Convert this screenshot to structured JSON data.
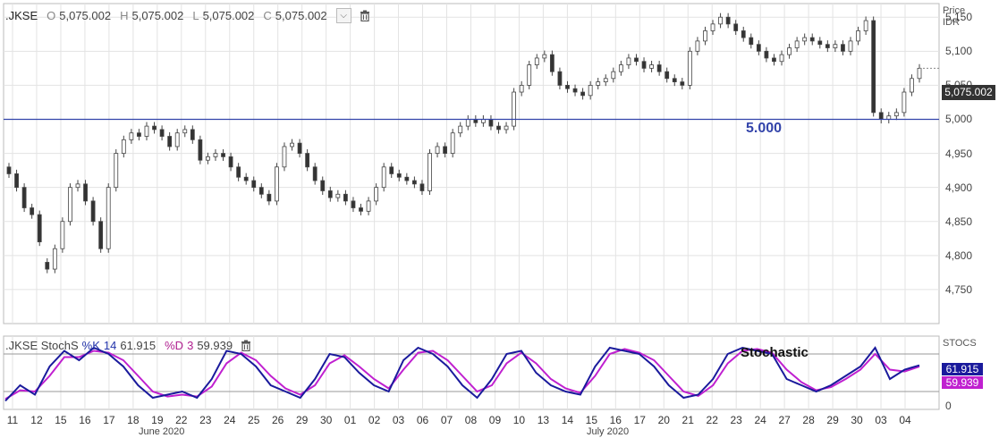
{
  "header": {
    "symbol": ".JKSE",
    "o_label": "O",
    "o_value": "5,075.002",
    "h_label": "H",
    "h_value": "5,075.002",
    "l_label": "L",
    "l_value": "5,075.002",
    "c_label": "C",
    "c_value": "5,075.002",
    "dropdown_icon": "chevron-down-icon",
    "trash_icon": "trash-icon"
  },
  "stoch_header": {
    "symbol": ".JKSE StochS",
    "k_label": "%K",
    "k_period": "14",
    "k_value": "61.915",
    "d_label": "%D",
    "d_period": "3",
    "d_value": "59.939",
    "trash_icon": "trash-icon"
  },
  "price_axis": {
    "title_line1": "Price",
    "title_line2": "IDR",
    "last_price_tag": "5,075.002"
  },
  "stoch_axis": {
    "title": "STOCS",
    "k_tag": "61.915",
    "d_tag": "59.939",
    "zero_label": "0"
  },
  "annotations": {
    "level_label": "5.000",
    "stoch_label": "Stochastic"
  },
  "months": [
    "June 2020",
    "July 2020"
  ],
  "colors": {
    "up": "#ffffff",
    "down": "#333333",
    "level_line": "#3344aa",
    "k_line": "#1a1a9c",
    "d_line": "#c020d0",
    "grid": "#e3e3e3"
  },
  "chart_data": [
    {
      "type": "candlestick",
      "title": ".JKSE",
      "ylabel": "Price IDR",
      "ylim": [
        4700,
        5170
      ],
      "yticks": [
        4750,
        4800,
        4850,
        4900,
        4950,
        5000,
        5050,
        5100,
        5150
      ],
      "ytick_labels": [
        "4,750",
        "4,800",
        "4,850",
        "4,900",
        "4,950",
        "5,000",
        "5,050",
        "5,100",
        "5,150"
      ],
      "x_labels": [
        "11",
        "12",
        "15",
        "16",
        "17",
        "18",
        "19",
        "22",
        "23",
        "24",
        "25",
        "26",
        "29",
        "30",
        "01",
        "02",
        "03",
        "06",
        "07",
        "08",
        "09",
        "10",
        "13",
        "14",
        "15",
        "16",
        "17",
        "20",
        "21",
        "22",
        "23",
        "24",
        "27",
        "28",
        "29",
        "30",
        "03",
        "04"
      ],
      "horizontal_line": {
        "value": 5000,
        "label": "5.000"
      },
      "last_price": 5075.002,
      "close": [
        4920,
        4900,
        4870,
        4860,
        4820,
        4780,
        4810,
        4850,
        4900,
        4905,
        4880,
        4850,
        4810,
        4900,
        4950,
        4970,
        4980,
        4975,
        4990,
        4985,
        4975,
        4960,
        4980,
        4985,
        4970,
        4940,
        4945,
        4950,
        4945,
        4930,
        4915,
        4910,
        4900,
        4890,
        4880,
        4930,
        4960,
        4965,
        4950,
        4930,
        4910,
        4895,
        4885,
        4890,
        4880,
        4870,
        4865,
        4880,
        4900,
        4930,
        4920,
        4915,
        4910,
        4905,
        4895,
        4950,
        4960,
        4950,
        4980,
        4990,
        5000,
        4995,
        5000,
        4990,
        4985,
        4990,
        5040,
        5050,
        5080,
        5090,
        5095,
        5070,
        5050,
        5045,
        5040,
        5035,
        5050,
        5055,
        5060,
        5070,
        5080,
        5090,
        5085,
        5075,
        5080,
        5070,
        5060,
        5055,
        5050,
        5100,
        5115,
        5130,
        5140,
        5150,
        5140,
        5130,
        5120,
        5110,
        5100,
        5090,
        5085,
        5095,
        5105,
        5115,
        5120,
        5115,
        5110,
        5105,
        5110,
        5100,
        5115,
        5130,
        5145,
        5010,
        5000,
        5005,
        5010,
        5040,
        5060,
        5075.002
      ],
      "open": [
        4930,
        4920,
        4900,
        4870,
        4860,
        4790,
        4780,
        4810,
        4850,
        4900,
        4905,
        4880,
        4850,
        4810,
        4900,
        4950,
        4970,
        4980,
        4975,
        4990,
        4985,
        4975,
        4960,
        4980,
        4985,
        4970,
        4940,
        4945,
        4950,
        4945,
        4930,
        4915,
        4910,
        4900,
        4890,
        4880,
        4930,
        4960,
        4965,
        4950,
        4930,
        4910,
        4895,
        4885,
        4890,
        4880,
        4870,
        4865,
        4880,
        4900,
        4930,
        4920,
        4915,
        4910,
        4905,
        4895,
        4950,
        4960,
        4950,
        4980,
        4990,
        5000,
        4995,
        5000,
        4990,
        4985,
        4990,
        5040,
        5050,
        5080,
        5090,
        5095,
        5070,
        5050,
        5045,
        5040,
        5035,
        5050,
        5055,
        5060,
        5070,
        5080,
        5090,
        5085,
        5075,
        5080,
        5070,
        5060,
        5055,
        5050,
        5100,
        5115,
        5130,
        5140,
        5150,
        5140,
        5130,
        5120,
        5110,
        5100,
        5090,
        5085,
        5095,
        5105,
        5115,
        5120,
        5115,
        5110,
        5105,
        5110,
        5100,
        5115,
        5130,
        5145,
        5010,
        5000,
        5005,
        5010,
        5040,
        5060
      ]
    },
    {
      "type": "line",
      "title": ".JKSE StochS",
      "ylabel": "STOCS",
      "ylim": [
        0,
        100
      ],
      "series": [
        {
          "name": "%K",
          "color": "#1a1a9c",
          "values": [
            5,
            30,
            15,
            60,
            85,
            70,
            90,
            80,
            60,
            30,
            10,
            15,
            20,
            10,
            40,
            85,
            80,
            60,
            30,
            20,
            10,
            40,
            80,
            75,
            50,
            30,
            20,
            70,
            90,
            80,
            60,
            30,
            10,
            40,
            80,
            85,
            50,
            30,
            20,
            15,
            60,
            90,
            85,
            80,
            60,
            30,
            10,
            15,
            40,
            80,
            90,
            85,
            80,
            40,
            30,
            20,
            30,
            45,
            60,
            90,
            40,
            55,
            61.915
          ]
        },
        {
          "name": "%D",
          "color": "#c020d0",
          "values": [
            8,
            22,
            20,
            45,
            75,
            75,
            85,
            82,
            70,
            45,
            20,
            12,
            15,
            12,
            28,
            65,
            82,
            70,
            45,
            25,
            15,
            30,
            65,
            78,
            60,
            40,
            25,
            55,
            82,
            85,
            70,
            45,
            20,
            30,
            65,
            82,
            65,
            40,
            25,
            18,
            45,
            80,
            88,
            82,
            70,
            45,
            20,
            13,
            30,
            65,
            85,
            88,
            82,
            55,
            35,
            22,
            27,
            40,
            55,
            80,
            55,
            52,
            59.939
          ]
        }
      ]
    }
  ]
}
